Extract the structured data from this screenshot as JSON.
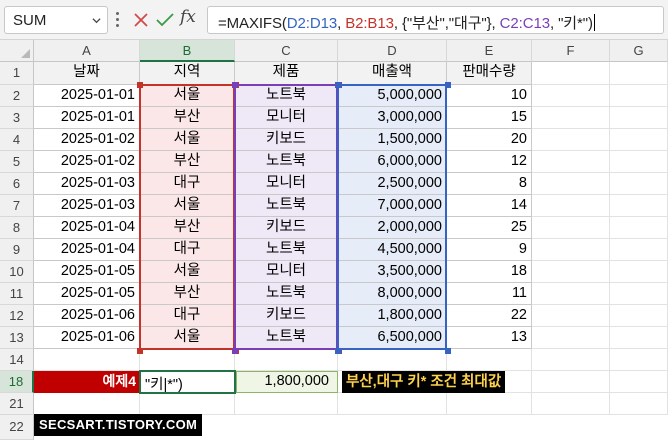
{
  "app": {
    "name_box": "SUM",
    "formula_tokens": [
      {
        "text": "=MAXIFS(",
        "cls": "tk-eq"
      },
      {
        "text": "D2:D13",
        "cls": "tk-blue"
      },
      {
        "text": ", ",
        "cls": "tk-dark"
      },
      {
        "text": "B2:B13",
        "cls": "tk-red"
      },
      {
        "text": ", {\"부산\",\"대구\"}, ",
        "cls": "tk-dark"
      },
      {
        "text": "C2:C13",
        "cls": "tk-purple"
      },
      {
        "text": ", \"키*\")",
        "cls": "tk-dark"
      }
    ],
    "fx_label": "fx"
  },
  "columns": [
    "A",
    "B",
    "C",
    "D",
    "E",
    "F",
    "G"
  ],
  "rows": [
    "1",
    "2",
    "3",
    "4",
    "5",
    "6",
    "7",
    "8",
    "9",
    "10",
    "11",
    "12",
    "13",
    "14",
    "18",
    "21",
    "22"
  ],
  "table": {
    "headers": [
      "날짜",
      "지역",
      "제품",
      "매출액",
      "판매수량"
    ],
    "rows": [
      [
        "2025-01-01",
        "서울",
        "노트북",
        "5,000,000",
        "10"
      ],
      [
        "2025-01-01",
        "부산",
        "모니터",
        "3,000,000",
        "15"
      ],
      [
        "2025-01-02",
        "서울",
        "키보드",
        "1,500,000",
        "20"
      ],
      [
        "2025-01-02",
        "부산",
        "노트북",
        "6,000,000",
        "12"
      ],
      [
        "2025-01-03",
        "대구",
        "모니터",
        "2,500,000",
        "8"
      ],
      [
        "2025-01-03",
        "서울",
        "노트북",
        "7,000,000",
        "14"
      ],
      [
        "2025-01-04",
        "부산",
        "키보드",
        "2,000,000",
        "25"
      ],
      [
        "2025-01-04",
        "대구",
        "노트북",
        "4,500,000",
        "9"
      ],
      [
        "2025-01-05",
        "서울",
        "모니터",
        "3,500,000",
        "18"
      ],
      [
        "2025-01-05",
        "부산",
        "노트북",
        "8,000,000",
        "11"
      ],
      [
        "2025-01-06",
        "대구",
        "키보드",
        "1,800,000",
        "22"
      ],
      [
        "2025-01-06",
        "서울",
        "노트북",
        "6,500,000",
        "13"
      ]
    ]
  },
  "example": {
    "label": "예제4",
    "editing_text": "\"키|*\")",
    "result": "1,800,000",
    "note": "부산,대구 키* 조건 최대값"
  },
  "watermark": "SECSART.TISTORY.COM",
  "colors": {
    "range_blue": "#3564c3",
    "range_red": "#c4332a",
    "range_purple": "#7a3fb6",
    "excel_green": "#217346",
    "label_red": "#c00000",
    "note_yellow": "#ffd24d"
  }
}
